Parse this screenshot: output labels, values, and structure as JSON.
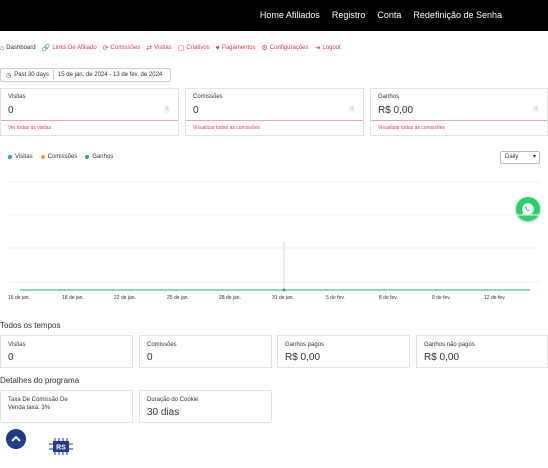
{
  "topnav": [
    "Home Afiliados",
    "Registro",
    "Conta",
    "Redefinição de Senha"
  ],
  "tabs": [
    {
      "icon": "⌂",
      "label": "Dashboard",
      "active": true,
      "name": "home"
    },
    {
      "icon": "🔗",
      "label": "Links De Afiliado",
      "name": "link"
    },
    {
      "icon": "⟳",
      "label": "Comissões",
      "name": "coins"
    },
    {
      "icon": "⇄",
      "label": "Visitas",
      "name": "share"
    },
    {
      "icon": "▢",
      "label": "Criativos",
      "name": "image"
    },
    {
      "icon": "♥",
      "label": "Pagamentos",
      "name": "payment"
    },
    {
      "icon": "⚙",
      "label": "Configurações",
      "name": "gear"
    },
    {
      "icon": "⇥",
      "label": "Logout",
      "name": "logout"
    }
  ],
  "daterange": {
    "preset": "Past 30 days",
    "range": "15 de jan. de 2024 - 13 de fev. de 2024"
  },
  "cards": [
    {
      "label": "Visitas",
      "value": "0",
      "link": "Ver todas as visitas"
    },
    {
      "label": "Comissões",
      "value": "0",
      "link": "Visualizar todas as comissões"
    },
    {
      "label": "Ganhos",
      "value": "R$ 0,00",
      "link": "Visualizar todas as comissões"
    }
  ],
  "legend": [
    {
      "label": "Visitas",
      "color": "#2a9fd6"
    },
    {
      "label": "Comissões",
      "color": "#f0a030"
    },
    {
      "label": "Ganhos",
      "color": "#2aa876"
    }
  ],
  "period_select": "Daily",
  "chart_data": {
    "type": "line",
    "x": [
      "16 de jan.",
      "18 de jan.",
      "22 de jan.",
      "25 de jan.",
      "28 de jan.",
      "31 de jan.",
      "5 de fev.",
      "8 de fev.",
      "8 de fev.",
      "12 de fev."
    ],
    "series": [
      {
        "name": "Visitas",
        "values": [
          0,
          0,
          0,
          0,
          0,
          0,
          0,
          0,
          0,
          0
        ]
      },
      {
        "name": "Comissões",
        "values": [
          0,
          0,
          0,
          0,
          0,
          0,
          0,
          0,
          0,
          0
        ]
      },
      {
        "name": "Ganhos",
        "values": [
          0,
          0,
          0,
          0,
          0,
          0,
          0,
          0,
          0,
          0
        ]
      }
    ]
  },
  "alltime": {
    "title": "Todos os tempos",
    "cards": [
      {
        "label": "Visitas",
        "value": "0"
      },
      {
        "label": "Comissões",
        "value": "0"
      },
      {
        "label": "Ganhos pagos",
        "value": "R$ 0,00"
      },
      {
        "label": "Ganhos não pagos",
        "value": "R$ 0,00"
      }
    ]
  },
  "program": {
    "title": "Detalhes do programa",
    "rate_label": "Taxa De Comissão De",
    "rate_value": "Venda taxa: 3%",
    "cookie_label": "Duração do Cookie",
    "cookie_value": "30 dias"
  },
  "logo_text": "RS"
}
